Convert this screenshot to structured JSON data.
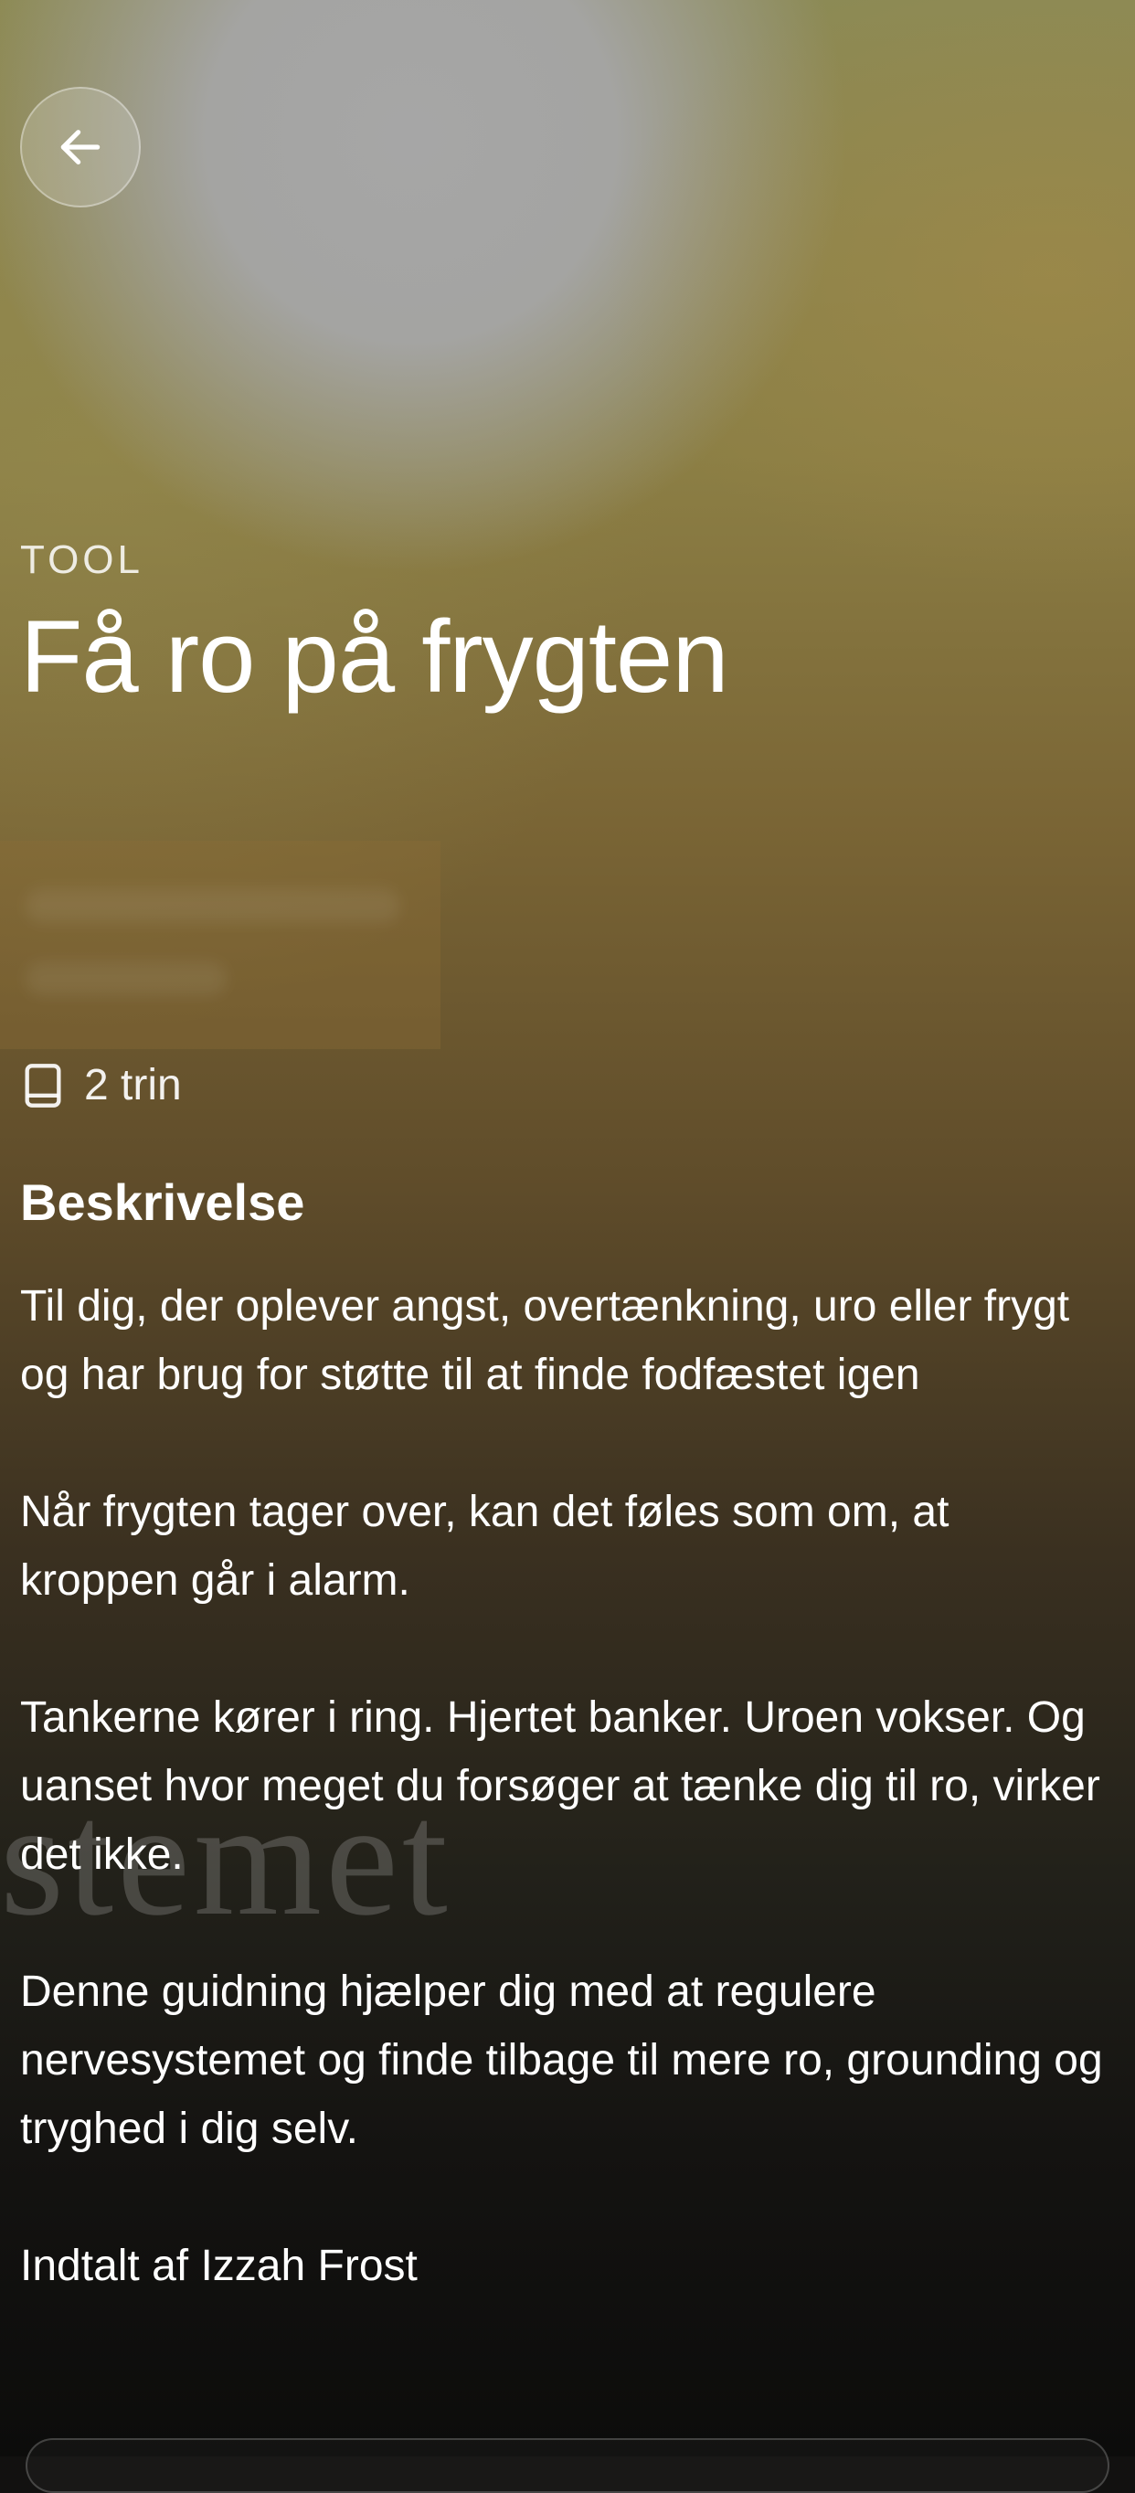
{
  "header": {
    "back_icon": "arrow-left-icon"
  },
  "tool": {
    "category": "TOOL",
    "title": "Få ro på frygten",
    "steps_icon": "book-icon",
    "steps_label": "2 trin"
  },
  "description": {
    "heading": "Beskrivelse",
    "paragraphs": [
      "Til dig, der oplever angst, overtænkning, uro eller frygt og har brug for støtte til at finde fodfæstet igen",
      "Når frygten tager over, kan det føles som om, at kroppen går i alarm.",
      "Tankerne kører i ring. Hjertet banker. Uroen vokser. Og uanset hvor meget du forsøger at tænke dig til ro, virker det ikke.",
      "Denne guidning hjælper dig med at regulere nervesystemet og finde tilbage til mere ro, grounding og tryghed i dig selv.",
      "Indtalt af Izzah Frost"
    ]
  },
  "background": {
    "partial_text": "stemet"
  },
  "colors": {
    "text": "#ffffff",
    "background_top": "#a6a6a6",
    "background_mid": "#7a6535",
    "background_bottom": "#0c0c0b"
  }
}
